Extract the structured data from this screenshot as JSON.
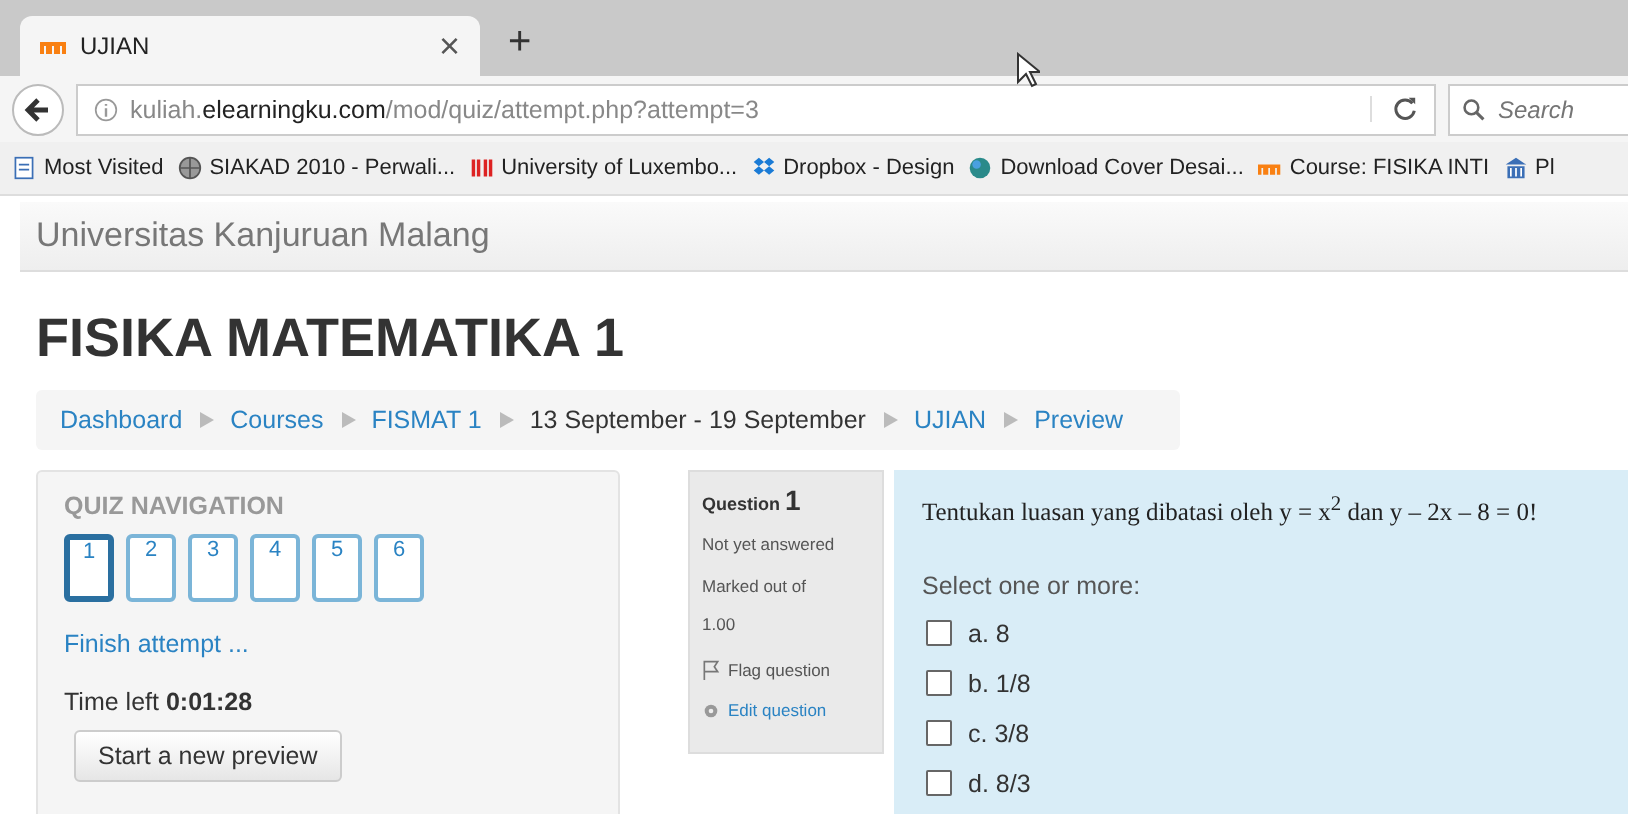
{
  "browser": {
    "tab": {
      "title": "UJIAN",
      "close": "×"
    },
    "new_tab": "+",
    "url": "kuliah.**elearningku.com**/mod/quiz/attempt.php?attempt=3",
    "search": {
      "placeholder": "Search"
    },
    "bookmarks": [
      {
        "label": "Most Visited",
        "kind": "page"
      },
      {
        "label": "SIAKAD 2010 - Perwali...",
        "kind": "globe"
      },
      {
        "label": "University of Luxembo...",
        "kind": "bars"
      },
      {
        "label": "Dropbox - Design",
        "kind": "dropbox"
      },
      {
        "label": "Download Cover Desai...",
        "kind": "dot"
      },
      {
        "label": "Course: FISIKA INTI",
        "kind": "moodle"
      },
      {
        "label": "Pl",
        "kind": "building"
      }
    ]
  },
  "site_name": "Universitas Kanjuruan Malang",
  "page_title": "FISIKA MATEMATIKA 1",
  "breadcrumb": [
    {
      "label": "Dashboard",
      "link": true
    },
    {
      "label": "Courses",
      "link": true
    },
    {
      "label": "FISMAT 1",
      "link": true
    },
    {
      "label": "13 September - 19 September",
      "link": false
    },
    {
      "label": "UJIAN",
      "link": true
    },
    {
      "label": "Preview",
      "link": true
    }
  ],
  "quiz_navigation": {
    "title": "QUIZ NAVIGATION",
    "questions": [
      {
        "label": "1",
        "selected": true
      },
      {
        "label": "2",
        "selected": false
      },
      {
        "label": "3",
        "selected": false
      },
      {
        "label": "4",
        "selected": false
      },
      {
        "label": "5",
        "selected": false
      },
      {
        "label": "6",
        "selected": false
      }
    ],
    "finish": "Finish attempt ...",
    "time_label": "Time left",
    "time_value": "0:01:28",
    "button": "Start a new preview"
  },
  "question_info": {
    "label": "Question",
    "number": "1",
    "status": "Not yet answered",
    "marked": "Marked out of",
    "mark": "1.00",
    "flag": "Flag question",
    "edit": "Edit question"
  },
  "question": {
    "text": "Tentukan luasan yang dibatasi oleh y = x$^{2}$ dan y – 2x – 8 = 0!",
    "prompt": "Select one or more:",
    "options": [
      {
        "label": "a. 8",
        "checked": false
      },
      {
        "label": "b. 1/8",
        "checked": false
      },
      {
        "label": "c. 3/8",
        "checked": false
      },
      {
        "label": "d. 8/3",
        "checked": false
      }
    ]
  }
}
